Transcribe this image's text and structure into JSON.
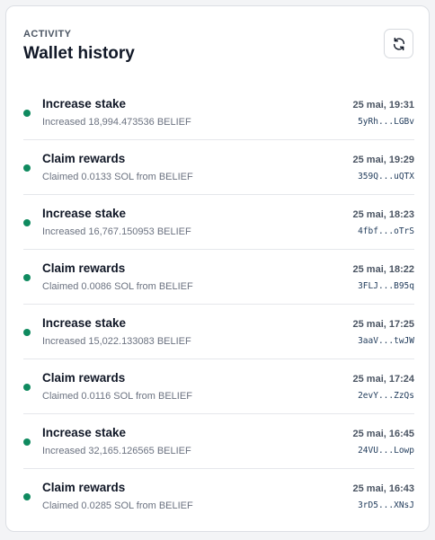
{
  "header": {
    "eyebrow": "ACTIVITY",
    "title": "Wallet history",
    "refresh_icon": "refresh-icon"
  },
  "colors": {
    "status_dot": "#0f8a5f",
    "signature": "#1f3a5a"
  },
  "items": [
    {
      "title": "Increase stake",
      "detail": "Increased 18,994.473536 BELIEF",
      "time": "25 mai, 19:31",
      "signature": "5yRh...LGBv"
    },
    {
      "title": "Claim rewards",
      "detail": "Claimed 0.0133 SOL from BELIEF",
      "time": "25 mai, 19:29",
      "signature": "359Q...uQTX"
    },
    {
      "title": "Increase stake",
      "detail": "Increased 16,767.150953 BELIEF",
      "time": "25 mai, 18:23",
      "signature": "4fbf...oTrS"
    },
    {
      "title": "Claim rewards",
      "detail": "Claimed 0.0086 SOL from BELIEF",
      "time": "25 mai, 18:22",
      "signature": "3FLJ...B95q"
    },
    {
      "title": "Increase stake",
      "detail": "Increased 15,022.133083 BELIEF",
      "time": "25 mai, 17:25",
      "signature": "3aaV...twJW"
    },
    {
      "title": "Claim rewards",
      "detail": "Claimed 0.0116 SOL from BELIEF",
      "time": "25 mai, 17:24",
      "signature": "2evY...ZzQs"
    },
    {
      "title": "Increase stake",
      "detail": "Increased 32,165.126565 BELIEF",
      "time": "25 mai, 16:45",
      "signature": "24VU...Lowp"
    },
    {
      "title": "Claim rewards",
      "detail": "Claimed 0.0285 SOL from BELIEF",
      "time": "25 mai, 16:43",
      "signature": "3rD5...XNsJ"
    }
  ]
}
